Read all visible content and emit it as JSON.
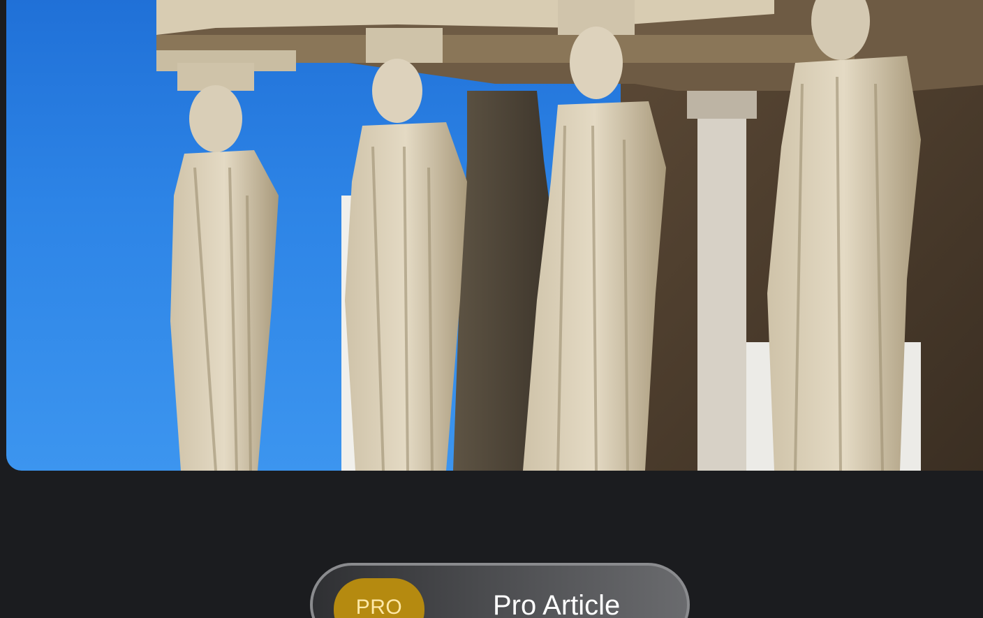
{
  "hero": {
    "image_icon": "caryatids-statues-photo"
  },
  "badge": {
    "tag": "PRO",
    "label": "Pro Article"
  },
  "colors": {
    "background": "#1b1c1f",
    "sky": "#2d84e6",
    "badge_gold": "#b58a10",
    "pill_border": "#8a8b8e"
  }
}
